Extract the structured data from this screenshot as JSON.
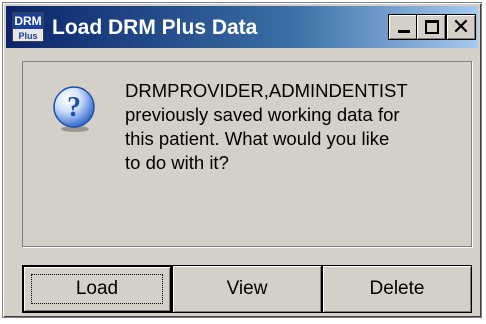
{
  "window": {
    "title": "Load DRM Plus Data",
    "icon_top": "DRM",
    "icon_bottom": "Plus"
  },
  "titlebar_controls": {
    "minimize": "minimize-icon",
    "maximize": "maximize-icon",
    "close": "close-icon"
  },
  "message": {
    "icon": "question-icon",
    "lines": [
      "DRMPROVIDER,ADMINDENTIST",
      "previously saved working data for",
      "this patient.  What would you like",
      "to do with it?"
    ]
  },
  "buttons": {
    "load": "Load",
    "view": "View",
    "delete": "Delete"
  },
  "colors": {
    "dialog_bg": "#d4d0c8",
    "title_start": "#0a246a",
    "title_end": "#a6caf0",
    "question_blue": "#1f4fa8"
  }
}
